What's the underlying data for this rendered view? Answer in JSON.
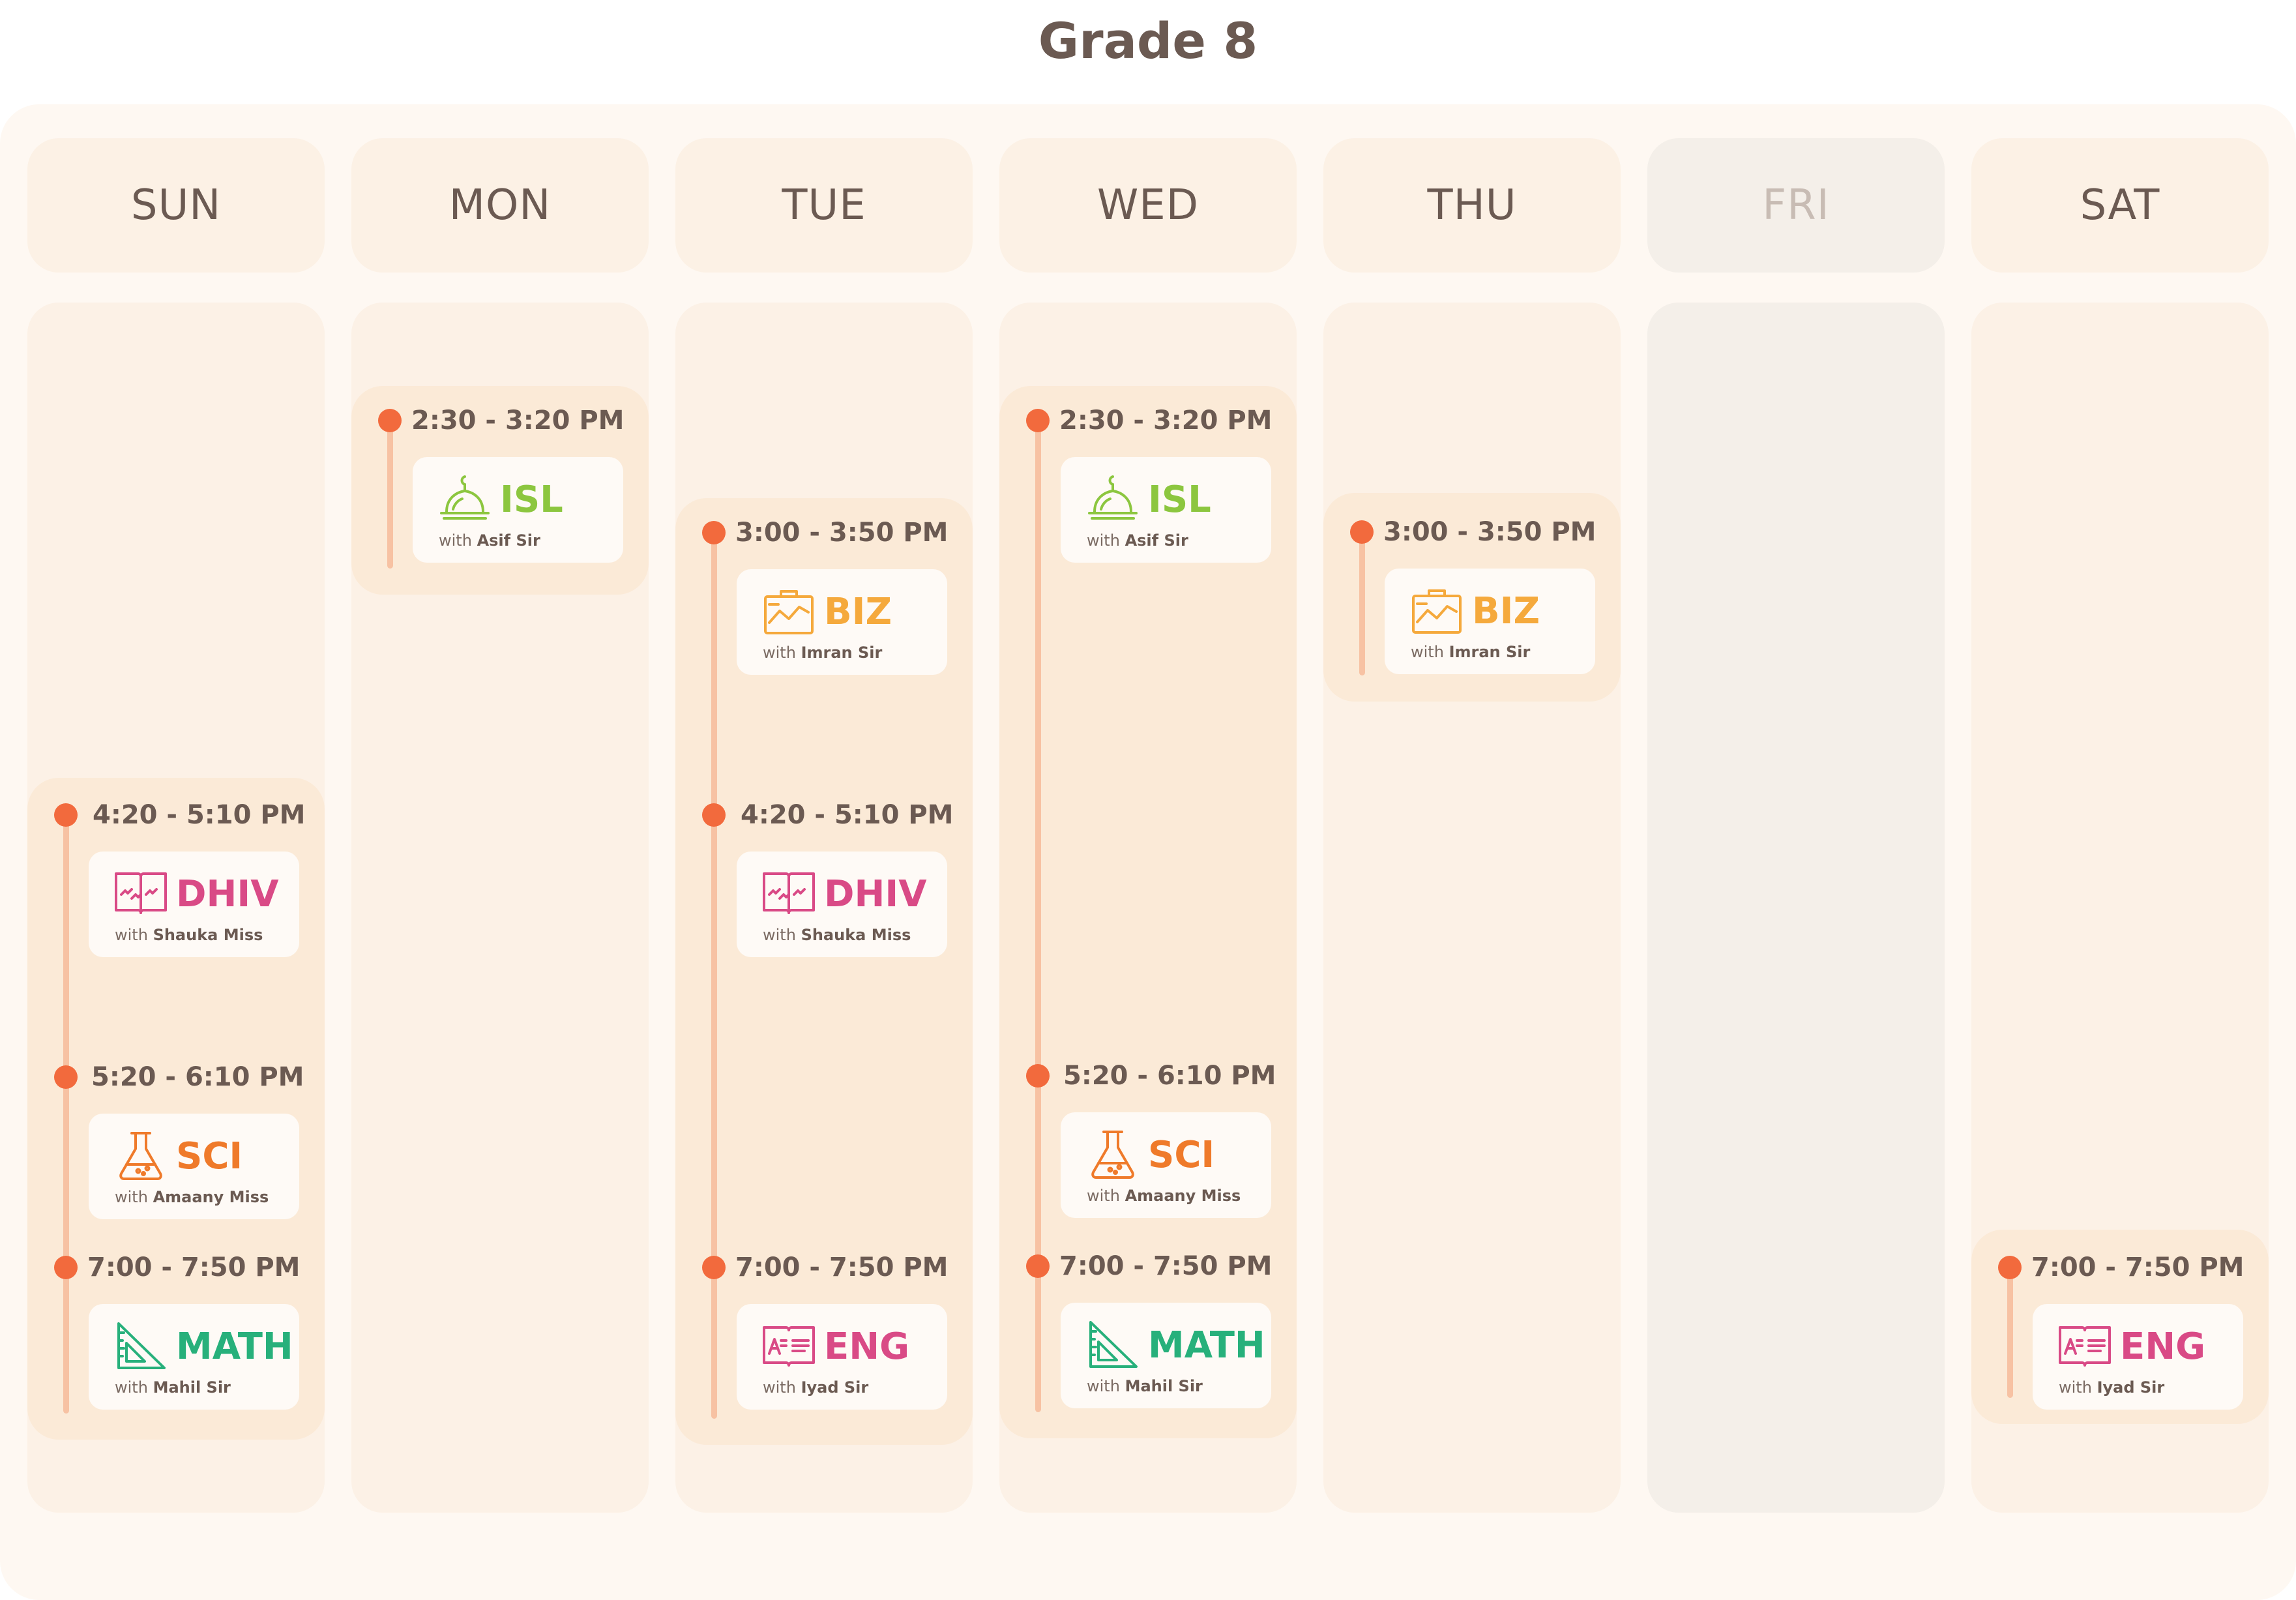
{
  "title": "Grade 8",
  "days": [
    {
      "label": "SUN",
      "off": false
    },
    {
      "label": "MON",
      "off": false
    },
    {
      "label": "TUE",
      "off": false
    },
    {
      "label": "WED",
      "off": false
    },
    {
      "label": "THU",
      "off": false
    },
    {
      "label": "FRI",
      "off": true
    },
    {
      "label": "SAT",
      "off": false
    }
  ],
  "subjects": {
    "ISL": {
      "label": "ISL",
      "icon": "mosque-dome-icon",
      "color": "#8cc63f"
    },
    "BIZ": {
      "label": "BIZ",
      "icon": "business-chart-icon",
      "color": "#f5a93c"
    },
    "DHIV": {
      "label": "DHIV",
      "icon": "open-book-script-icon",
      "color": "#d94a86"
    },
    "SCI": {
      "label": "SCI",
      "icon": "flask-icon",
      "color": "#ef7a2a"
    },
    "MATH": {
      "label": "MATH",
      "icon": "set-square-icon",
      "color": "#27b07b"
    },
    "ENG": {
      "label": "ENG",
      "icon": "english-book-icon",
      "color": "#d94a86"
    }
  },
  "with_prefix": "with",
  "colors": {
    "dot": "#f26a3d",
    "timeline": "#f7c2a3",
    "block": "#fbead7",
    "column": "#fcf1e6",
    "off_column": "#f4efe9",
    "text": "#6b5a52"
  },
  "schedule": {
    "SUN": [
      {
        "time": "4:20 - 5:10 PM",
        "subject": "DHIV",
        "teacher": "Shauka Miss"
      },
      {
        "time": "5:20 - 6:10 PM",
        "subject": "SCI",
        "teacher": "Amaany Miss"
      },
      {
        "time": "7:00 - 7:50 PM",
        "subject": "MATH",
        "teacher": "Mahil Sir"
      }
    ],
    "MON": [
      {
        "time": "2:30 - 3:20 PM",
        "subject": "ISL",
        "teacher": "Asif Sir"
      }
    ],
    "TUE": [
      {
        "time": "3:00 - 3:50 PM",
        "subject": "BIZ",
        "teacher": "Imran Sir"
      },
      {
        "time": "4:20 - 5:10 PM",
        "subject": "DHIV",
        "teacher": "Shauka Miss"
      },
      {
        "time": "7:00 - 7:50 PM",
        "subject": "ENG",
        "teacher": "Iyad Sir"
      }
    ],
    "WED": [
      {
        "time": "2:30 - 3:20 PM",
        "subject": "ISL",
        "teacher": "Asif Sir"
      },
      {
        "time": "5:20 - 6:10 PM",
        "subject": "SCI",
        "teacher": "Amaany Miss"
      },
      {
        "time": "7:00 - 7:50 PM",
        "subject": "MATH",
        "teacher": "Mahil Sir"
      }
    ],
    "THU": [
      {
        "time": "3:00 - 3:50 PM",
        "subject": "BIZ",
        "teacher": "Imran Sir"
      }
    ],
    "FRI": [],
    "SAT": [
      {
        "time": "7:00 - 7:50 PM",
        "subject": "ENG",
        "teacher": "Iyad Sir"
      }
    ]
  }
}
